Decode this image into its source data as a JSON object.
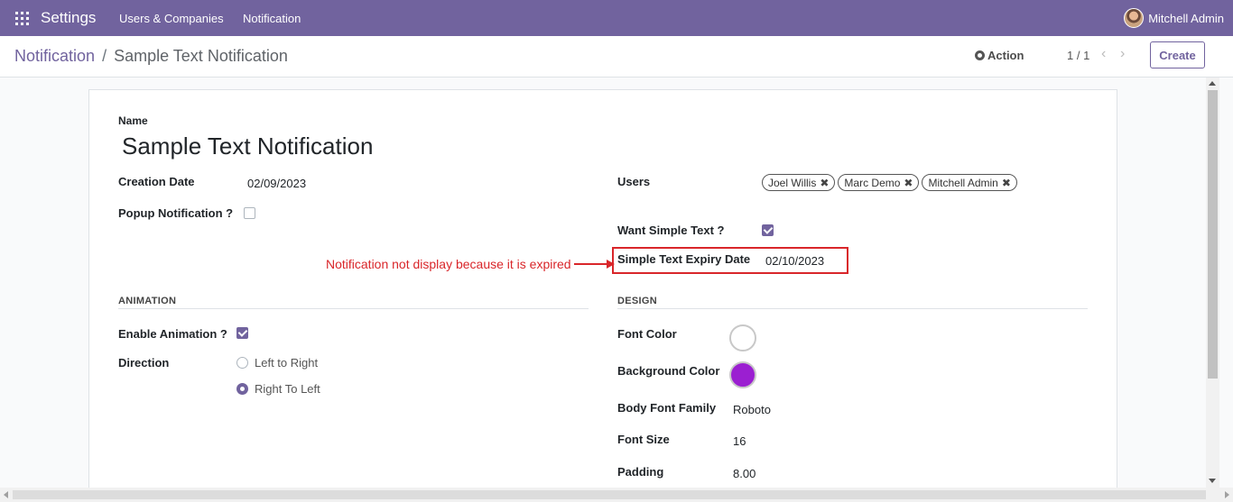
{
  "navbar": {
    "brand": "Settings",
    "menu": [
      "Users & Companies",
      "Notification"
    ],
    "user": "Mitchell Admin"
  },
  "control": {
    "breadcrumb_parent": "Notification",
    "breadcrumb_sep": "/",
    "breadcrumb_current": "Sample Text Notification",
    "action_label": "Action",
    "pager": "1 / 1",
    "create_label": "Create"
  },
  "form": {
    "name_label": "Name",
    "name_value": "Sample Text Notification",
    "creation_date_label": "Creation Date",
    "creation_date_value": "02/09/2023",
    "popup_label": "Popup Notification ?",
    "popup_checked": false,
    "users_label": "Users",
    "users": [
      "Joel Willis",
      "Marc Demo",
      "Mitchell Admin"
    ],
    "want_simple_text_label": "Want Simple Text ?",
    "want_simple_text_checked": true,
    "expiry_label": "Simple Text Expiry Date",
    "expiry_value": "02/10/2023",
    "annotation": "Notification not display because it is expired"
  },
  "animation": {
    "header": "ANIMATION",
    "enable_label": "Enable Animation ?",
    "enable_checked": true,
    "direction_label": "Direction",
    "options": [
      "Left to Right",
      "Right To Left"
    ],
    "selected": "Right To Left"
  },
  "design": {
    "header": "DESIGN",
    "font_color_label": "Font Color",
    "font_color_value": "#ffffff",
    "background_color_label": "Background Color",
    "background_color_value": "#9b1fd1",
    "body_font_family_label": "Body Font Family",
    "body_font_family_value": "Roboto",
    "font_size_label": "Font Size",
    "font_size_value": "16",
    "padding_label": "Padding",
    "padding_value": "8.00"
  }
}
